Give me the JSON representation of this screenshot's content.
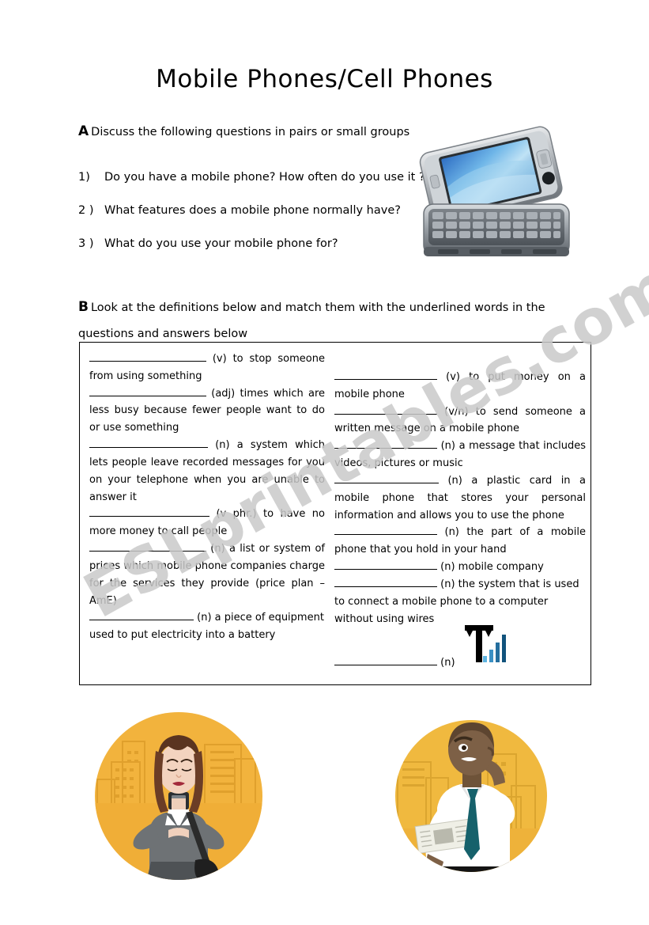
{
  "document": {
    "title": "Mobile Phones/Cell Phones",
    "watermark": "ESLprintables.com"
  },
  "section_a": {
    "letter": "A",
    "instruction": "Discuss the following questions in pairs or small groups",
    "questions": [
      {
        "number": "1)",
        "text": "Do you have a mobile phone? How often do you use it ?"
      },
      {
        "number": "2 )",
        "text": "What features does a mobile phone normally have?"
      },
      {
        "number": "3 )",
        "text": "What do you use your mobile phone for?"
      }
    ]
  },
  "section_b": {
    "letter": "B",
    "instruction": "Look at the definitions below and match them with the underlined words in the questions and answers below",
    "left_column": [
      {
        "pos": "(v)",
        "definition": "to stop someone from using something"
      },
      {
        "pos": "(adj)",
        "definition": "times which are less busy because fewer people want to do or use something"
      },
      {
        "pos": "(n)",
        "definition": "a system which lets people leave recorded messages for you on your telephone when you are unable to answer it"
      },
      {
        "pos": "(v phr.)",
        "definition": "to have no more money to call people"
      },
      {
        "pos": "(n)",
        "definition": "a list or system of prices which mobile phone companies charge for the services they provide (price plan – AmE)"
      },
      {
        "pos": "(n)",
        "definition": "a piece of equipment used to put electricity into a battery"
      }
    ],
    "right_column": [
      {
        "pos": "(v)",
        "definition": "to put money on a mobile phone"
      },
      {
        "pos": "(v/n)",
        "definition": "to send someone a written message on a mobile phone"
      },
      {
        "pos": "(n)",
        "definition": "a message that includes videos, pictures or music"
      },
      {
        "pos": "(n)",
        "definition": "a plastic card in a mobile phone that stores your personal information and allows you to use the phone"
      },
      {
        "pos": "(n)",
        "definition": "the part of a mobile phone that you hold in your hand"
      },
      {
        "pos": "(n)",
        "definition": "mobile company"
      },
      {
        "pos": "(n)",
        "definition": "the system that is used to connect a mobile phone to a computer without using wires"
      }
    ],
    "icon_entry": {
      "pos": "(n)",
      "icon": "signal-strength-icon"
    }
  },
  "images": {
    "phone_photo": "slider-smartphone-photo",
    "illustration_left": "businesswoman-texting-illustration",
    "illustration_right": "businessman-calling-illustration"
  },
  "colors": {
    "text": "#000000",
    "watermark": "#c9c9c9",
    "box_border": "#000000",
    "illustration_circle": "#f2b33d",
    "signal_bar_light": "#4aa8dd",
    "signal_bar_dark": "#0d4f77",
    "tie": "#16616b",
    "shirt": "#ffffff",
    "suit_grey": "#6e7275"
  }
}
